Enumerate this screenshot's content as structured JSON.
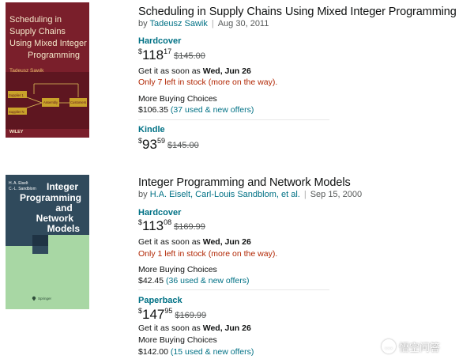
{
  "results": [
    {
      "cover": {
        "title_lines": [
          "Scheduling in",
          "Supply Chains",
          "Using Mixed Integer",
          "Programming"
        ],
        "author": "Tadeusz Sawik",
        "publisher": "WILEY",
        "colors": {
          "background": "#7a1f2b",
          "panel": "#5e1620",
          "box": "#c9a22a",
          "text": "#f3e7c9"
        },
        "diagram_labels": [
          "Supplier 1",
          "Supplier N",
          "Assembly",
          "Customers"
        ]
      },
      "title": "Scheduling in Supply Chains Using Mixed Integer Programming",
      "by_prefix": "by",
      "authors": "Tadeusz Sawik",
      "date": "Aug 30, 2011",
      "formats": [
        {
          "name": "Hardcover",
          "price": {
            "symbol": "$",
            "whole": "118",
            "fraction": "17",
            "list": "$145.00"
          },
          "delivery_prefix": "Get it as soon as",
          "delivery_date": "Wed, Jun 26",
          "stock": "Only 7 left in stock (more on the way).",
          "more_choices": "More Buying Choices",
          "offer_price": "$106.35",
          "offer_link": "(37 used & new offers)"
        },
        {
          "name": "Kindle",
          "price": {
            "symbol": "$",
            "whole": "93",
            "fraction": "59",
            "list": "$145.00"
          }
        }
      ]
    },
    {
      "cover": {
        "authors_small": [
          "H. A. Eiselt",
          "C.-L. Sandblom"
        ],
        "title_lines": [
          "Integer",
          "Programming",
          "and",
          "Network",
          "Models"
        ],
        "publisher": "Springer",
        "colors": {
          "top": "#304a5c",
          "bottom": "#a8d7a4",
          "accent": "#223848",
          "text": "#ffffff"
        }
      },
      "title": "Integer Programming and Network Models",
      "by_prefix": "by",
      "authors": "H.A. Eiselt, Carl-Louis Sandblom, et al.",
      "date": "Sep 15, 2000",
      "formats": [
        {
          "name": "Hardcover",
          "price": {
            "symbol": "$",
            "whole": "113",
            "fraction": "08",
            "list": "$169.99"
          },
          "delivery_prefix": "Get it as soon as",
          "delivery_date": "Wed, Jun 26",
          "stock": "Only 1 left in stock (more on the way).",
          "more_choices": "More Buying Choices",
          "offer_price": "$42.45",
          "offer_link": "(36 used & new offers)"
        },
        {
          "name": "Paperback",
          "price": {
            "symbol": "$",
            "whole": "147",
            "fraction": "95",
            "list": "$169.99"
          },
          "delivery_prefix": "Get it as soon as",
          "delivery_date": "Wed, Jun 26",
          "more_choices": "More Buying Choices",
          "offer_price": "$142.00",
          "offer_link": "(15 used & new offers)"
        }
      ]
    }
  ],
  "watermark": {
    "text": "悟空问答",
    "icon": "speech-bubble-icon"
  }
}
